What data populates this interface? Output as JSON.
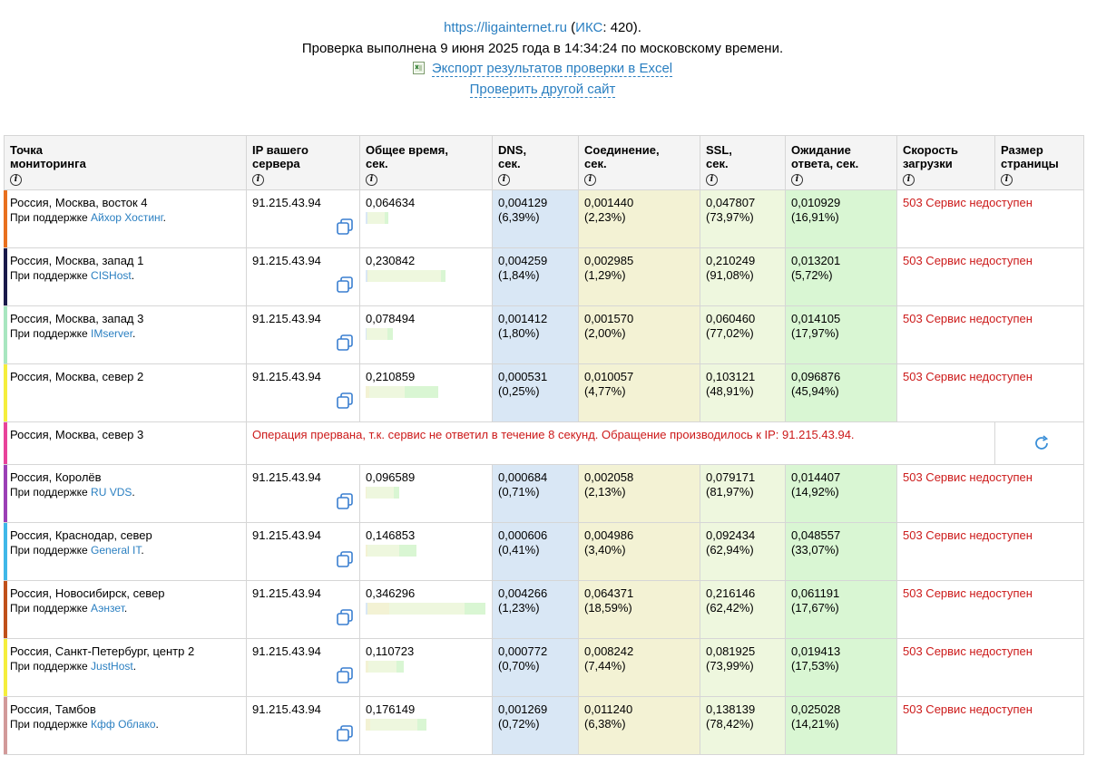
{
  "header": {
    "site_url": "https://ligainternet.ru",
    "iks_label": "ИКС",
    "iks_value": "420",
    "checked_text": "Проверка выполнена 9 июня 2025 года в 14:34:24 по московскому времени.",
    "export_label": "Экспорт результатов проверки в Excel",
    "other_site_label": "Проверить другой сайт"
  },
  "columns": [
    {
      "line1": "Точка",
      "line2": "мониторинга"
    },
    {
      "line1": "IP вашего",
      "line2": "сервера"
    },
    {
      "line1": "Общее время,",
      "line2": "сек."
    },
    {
      "line1": "DNS,",
      "line2": "сек."
    },
    {
      "line1": "Соединение,",
      "line2": "сек."
    },
    {
      "line1": "SSL,",
      "line2": "сек."
    },
    {
      "line1": "Ожидание",
      "line2": "ответа, сек."
    },
    {
      "line1": "Скорость",
      "line2": "загрузки"
    },
    {
      "line1": "Размер",
      "line2": "страницы"
    }
  ],
  "info_glyph": "i",
  "support_prefix": "При поддержке",
  "rows": [
    {
      "location": "Россия, Москва, восток 4",
      "sponsor": "Айхор Хостинг",
      "accent": "#e8701f",
      "ip": "91.215.43.94",
      "total": "0,064634",
      "total_frac": 0.187,
      "dns": "0,004129",
      "dns_pct": "(6,39%)",
      "conn": "0,001440",
      "conn_pct": "(2,23%)",
      "ssl": "0,047807",
      "ssl_pct": "(73,97%)",
      "wait": "0,010929",
      "wait_pct": "(16,91%)",
      "status": "503 Сервис недоступен"
    },
    {
      "location": "Россия, Москва, запад 1",
      "sponsor": "CISHost",
      "accent": "#1a1a4a",
      "ip": "91.215.43.94",
      "total": "0,230842",
      "total_frac": 0.667,
      "dns": "0,004259",
      "dns_pct": "(1,84%)",
      "conn": "0,002985",
      "conn_pct": "(1,29%)",
      "ssl": "0,210249",
      "ssl_pct": "(91,08%)",
      "wait": "0,013201",
      "wait_pct": "(5,72%)",
      "status": "503 Сервис недоступен"
    },
    {
      "location": "Россия, Москва, запад 3",
      "sponsor": "IMserver",
      "accent": "#a8e6c0",
      "ip": "91.215.43.94",
      "total": "0,078494",
      "total_frac": 0.227,
      "dns": "0,001412",
      "dns_pct": "(1,80%)",
      "conn": "0,001570",
      "conn_pct": "(2,00%)",
      "ssl": "0,060460",
      "ssl_pct": "(77,02%)",
      "wait": "0,014105",
      "wait_pct": "(17,97%)",
      "status": "503 Сервис недоступен"
    },
    {
      "location": "Россия, Москва, север 2",
      "sponsor": "",
      "accent": "#f5ee3c",
      "ip": "91.215.43.94",
      "total": "0,210859",
      "total_frac": 0.609,
      "dns": "0,000531",
      "dns_pct": "(0,25%)",
      "conn": "0,010057",
      "conn_pct": "(4,77%)",
      "ssl": "0,103121",
      "ssl_pct": "(48,91%)",
      "wait": "0,096876",
      "wait_pct": "(45,94%)",
      "status": "503 Сервис недоступен"
    },
    {
      "location": "Россия, Москва, север 3",
      "accent": "#e8439a",
      "error": "Операция прервана, т.к. сервис не ответил в течение 8 секунд. Обращение производилось к IP: 91.215.43.94."
    },
    {
      "location": "Россия, Королёв",
      "sponsor": "RU VDS",
      "accent": "#9b3fb5",
      "ip": "91.215.43.94",
      "total": "0,096589",
      "total_frac": 0.279,
      "dns": "0,000684",
      "dns_pct": "(0,71%)",
      "conn": "0,002058",
      "conn_pct": "(2,13%)",
      "ssl": "0,079171",
      "ssl_pct": "(81,97%)",
      "wait": "0,014407",
      "wait_pct": "(14,92%)",
      "status": "503 Сервис недоступен"
    },
    {
      "location": "Россия, Краснодар, север",
      "sponsor": "General IT",
      "accent": "#3fb7e8",
      "ip": "91.215.43.94",
      "total": "0,146853",
      "total_frac": 0.424,
      "dns": "0,000606",
      "dns_pct": "(0,41%)",
      "conn": "0,004986",
      "conn_pct": "(3,40%)",
      "ssl": "0,092434",
      "ssl_pct": "(62,94%)",
      "wait": "0,048557",
      "wait_pct": "(33,07%)",
      "status": "503 Сервис недоступен"
    },
    {
      "location": "Россия, Новосибирск, север",
      "sponsor": "Аэнзет",
      "accent": "#c0501a",
      "ip": "91.215.43.94",
      "total": "0,346296",
      "total_frac": 1.0,
      "dns": "0,004266",
      "dns_pct": "(1,23%)",
      "conn": "0,064371",
      "conn_pct": "(18,59%)",
      "ssl": "0,216146",
      "ssl_pct": "(62,42%)",
      "wait": "0,061191",
      "wait_pct": "(17,67%)",
      "status": "503 Сервис недоступен"
    },
    {
      "location": "Россия, Санкт-Петербург, центр 2",
      "sponsor": "JustHost",
      "accent": "#f5ee3c",
      "ip": "91.215.43.94",
      "total": "0,110723",
      "total_frac": 0.32,
      "dns": "0,000772",
      "dns_pct": "(0,70%)",
      "conn": "0,008242",
      "conn_pct": "(7,44%)",
      "ssl": "0,081925",
      "ssl_pct": "(73,99%)",
      "wait": "0,019413",
      "wait_pct": "(17,53%)",
      "status": "503 Сервис недоступен"
    },
    {
      "location": "Россия, Тамбов",
      "sponsor": "Кфф Облако",
      "accent": "#d29a9a",
      "ip": "91.215.43.94",
      "total": "0,176149",
      "total_frac": 0.509,
      "dns": "0,001269",
      "dns_pct": "(0,72%)",
      "conn": "0,011240",
      "conn_pct": "(6,38%)",
      "ssl": "0,138139",
      "ssl_pct": "(78,42%)",
      "wait": "0,025028",
      "wait_pct": "(14,21%)",
      "status": "503 Сервис недоступен"
    }
  ],
  "colors": {
    "dns": "#d9e7f5",
    "conn": "#f3f2d4",
    "ssl": "#eef7de",
    "wait": "#d9f6d3",
    "error": "#cc1a1a",
    "link": "#2a7fc1"
  }
}
